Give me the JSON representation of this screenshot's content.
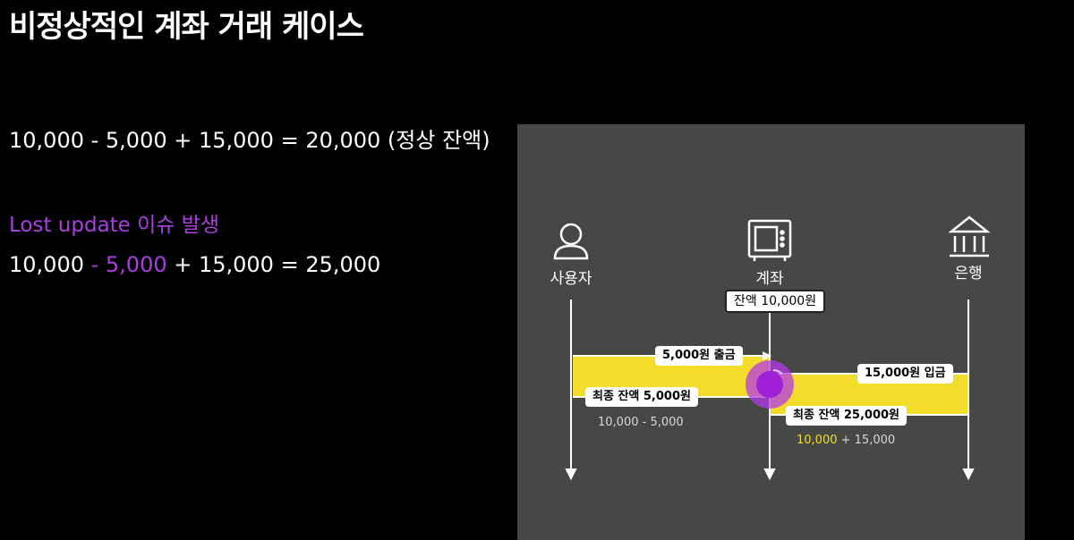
{
  "title": "비정상적인 계좌 거래 케이스",
  "equation_normal": "10,000 - 5,000 + 15,000 = 20,000 (정상 잔액)",
  "lost_update": "Lost update 이슈 발생",
  "equation_lost": {
    "part1": "10,000 ",
    "part2": "- 5,000",
    "part3": " + 15,000 = 25,000"
  },
  "diagram": {
    "actors": {
      "user": {
        "label": "사용자",
        "icon": "user-icon"
      },
      "account": {
        "label": "계좌",
        "icon": "safe-icon"
      },
      "bank": {
        "label": "은행",
        "icon": "bank-icon"
      }
    },
    "account_balance": "잔액 10,000원",
    "withdraw_label": "5,000원 출금",
    "deposit_label": "15,000원 입금",
    "user_final": "최종 잔액  5,000원",
    "user_calc": "10,000 - 5,000",
    "bank_final": "최종 잔액  25,000원",
    "bank_calc": {
      "highlight": "10,000",
      "rest": " + 15,000"
    },
    "colors": {
      "panel": "#464845",
      "band": "#f4dc2a",
      "accent": "#a93fe0",
      "collision": "#b43ae8"
    }
  }
}
